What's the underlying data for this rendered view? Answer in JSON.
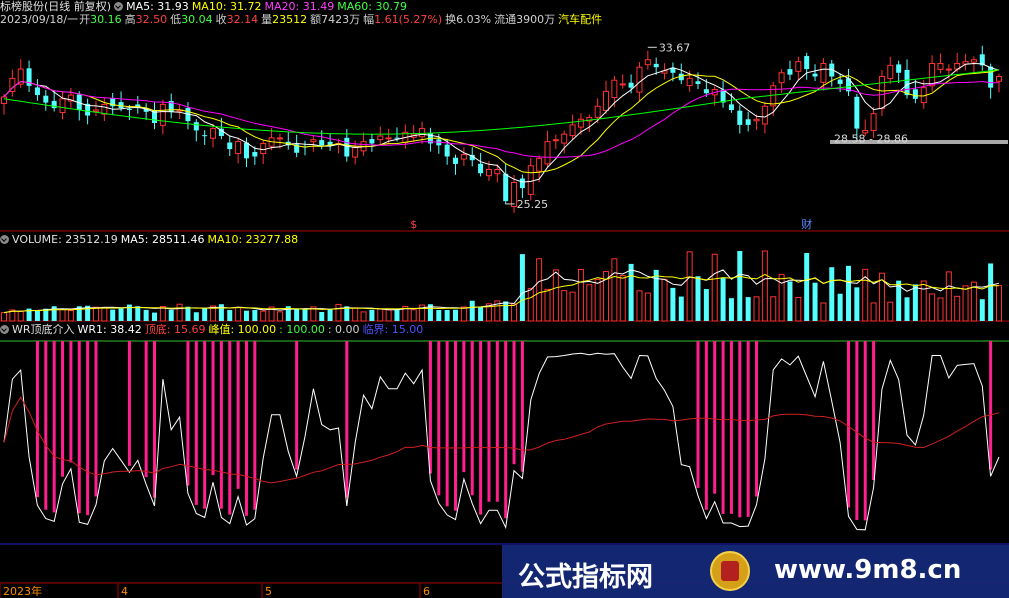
{
  "header": {
    "title": "标榜股份(日线 前复权)",
    "ma5": "MA5: 31.93",
    "ma10": "MA10: 31.72",
    "ma20": "MA20: 31.49",
    "ma60": "MA60: 30.79",
    "date": "2023/09/18/一",
    "open_label": "开",
    "open": "30.16",
    "high_label": "高",
    "high": "32.50",
    "low_label": "低",
    "low": "30.04",
    "close_label": "收",
    "close": "32.14",
    "vol_label": "量",
    "vol": "23512",
    "amount": "额7423万",
    "change_label": "幅",
    "change": "1.61(5.27%)",
    "turnover": "换6.03%",
    "float": "流通3900万",
    "sector": "汽车配件"
  },
  "volume_panel": {
    "title": "VOLUME: 23512.19",
    "ma5": "MA5: 28511.46",
    "ma10": "MA10: 23277.88"
  },
  "wr_panel": {
    "title": "WR顶底介入",
    "wr1": "WR1: 38.42",
    "bottom": "顶底: 15.69",
    "peak": "峰值: 100.00",
    "v100": ": 100.00",
    "v0": ": 0.00",
    "critical": "临界: 15.00"
  },
  "price_annotations": {
    "high": "33.67",
    "low": "25.25",
    "range": "28.58 - 28.86",
    "marker_s": "$",
    "marker_cai": "财"
  },
  "time_axis": [
    "2023年",
    "4",
    "5",
    "6"
  ],
  "watermark": {
    "left": "公式指标网",
    "right": "www.9m8.cn"
  },
  "colors": {
    "up": "#ff3232",
    "down": "#54ffff",
    "ma5": "#ffffff",
    "ma10": "#ffff00",
    "ma20": "#ff00ff",
    "ma60": "#00ff00",
    "wr_bar": "#ff1f8e",
    "wr_line": "#ffffff",
    "wr_ma": "#d01f1f",
    "grid_red": "#aa0000"
  },
  "chart_data": [
    {
      "type": "candlestick",
      "title": "标榜股份(日线 前复权)",
      "series": [
        {
          "name": "MA5",
          "last": 31.93
        },
        {
          "name": "MA10",
          "last": 31.72
        },
        {
          "name": "MA20",
          "last": 31.49
        },
        {
          "name": "MA60",
          "last": 30.79
        }
      ],
      "last_bar": {
        "open": 30.16,
        "high": 32.5,
        "low": 30.04,
        "close": 32.14
      },
      "marked_high": 33.67,
      "marked_low": 25.25,
      "closes": [
        31.0,
        32.0,
        32.5,
        31.6,
        31.1,
        30.7,
        30.4,
        30.9,
        31.1,
        30.3,
        30.0,
        30.3,
        30.6,
        30.5,
        30.4,
        30.3,
        30.4,
        30.2,
        29.6,
        30.6,
        30.2,
        30.3,
        29.7,
        29.2,
        28.9,
        29.3,
        28.9,
        28.2,
        28.6,
        27.7,
        27.8,
        28.5,
        28.8,
        28.8,
        28.4,
        28.0,
        28.3,
        28.7,
        28.4,
        28.4,
        28.5,
        27.8,
        28.3,
        28.6,
        28.5,
        28.9,
        28.8,
        28.8,
        29.1,
        29.0,
        29.3,
        28.5,
        28.4,
        27.8,
        27.4,
        27.9,
        27.6,
        26.9,
        27.1,
        27.1,
        25.4,
        26.4,
        26.1,
        27.3,
        27.7,
        28.6,
        28.7,
        29.0,
        29.5,
        29.8,
        29.9,
        30.5,
        31.3,
        31.9,
        31.7,
        31.5,
        32.6,
        33.0,
        32.6,
        32.4,
        32.3,
        31.9,
        32.0,
        31.7,
        31.2,
        31.4,
        30.7,
        30.3,
        29.5,
        29.5,
        29.8,
        30.5,
        31.6,
        32.3,
        32.2,
        32.9,
        32.5,
        32.1,
        32.8,
        32.1,
        31.7,
        31.3,
        29.3,
        29.2,
        30.1,
        32.1,
        32.7,
        32.3,
        31.1,
        30.9,
        31.5,
        32.8,
        32.8,
        32.5,
        32.8,
        32.9,
        33.0,
        32.7,
        31.5,
        32.1
      ]
    },
    {
      "type": "bar",
      "title": "VOLUME",
      "series": [
        {
          "name": "VOLUME",
          "last": 23512.19
        },
        {
          "name": "MA5",
          "last": 28511.46
        },
        {
          "name": "MA10",
          "last": 23277.88
        }
      ]
    },
    {
      "type": "line",
      "title": "WR顶底介入",
      "series": [
        {
          "name": "WR1",
          "last": 38.42
        },
        {
          "name": "顶底",
          "last": 15.69
        },
        {
          "name": "峰值",
          "last": 100.0
        },
        {
          "name": "临界",
          "last": 15.0
        }
      ],
      "ylim": [
        0,
        100
      ]
    }
  ]
}
